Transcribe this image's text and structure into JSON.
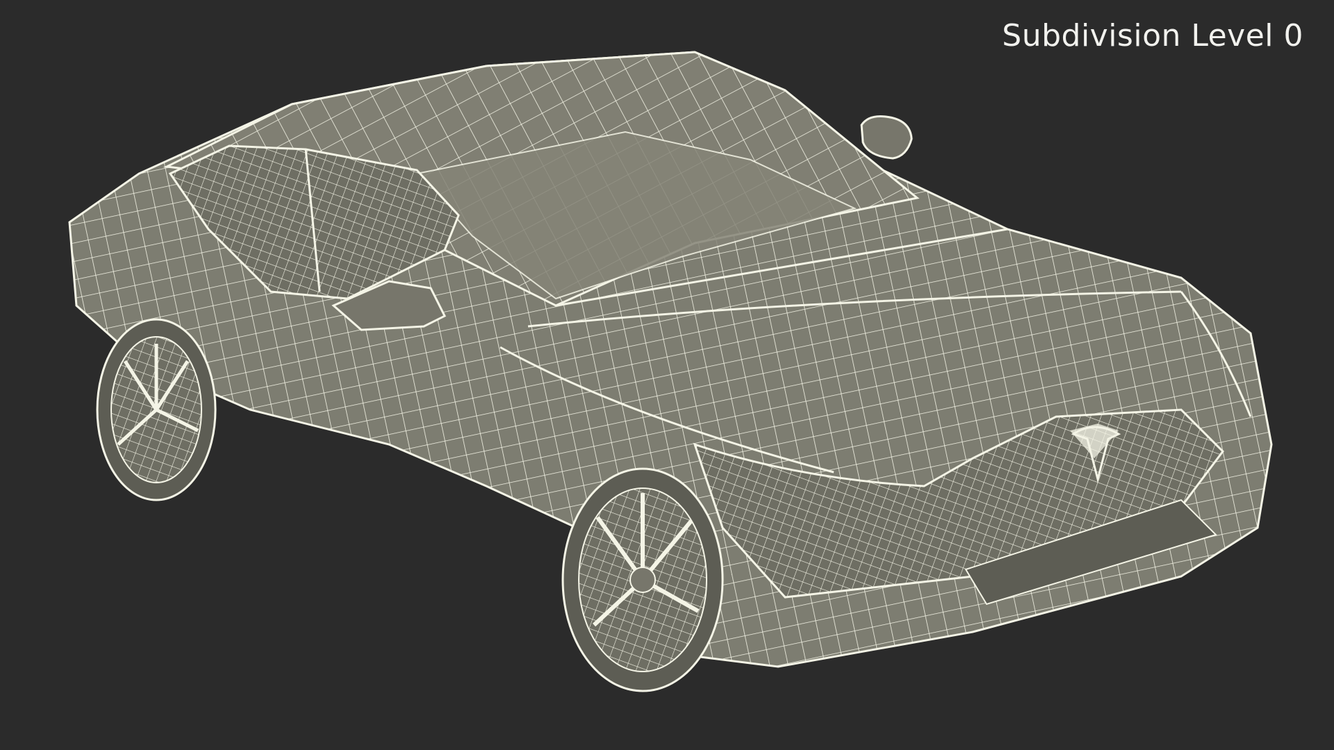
{
  "viewport": {
    "label": "Subdivision Level 0"
  },
  "colors": {
    "background": "#2b2b2b",
    "surface": "#7d7d71",
    "surface_dark": "#5d5d54",
    "wire": "#f4f4e6",
    "label": "#f2f2ee"
  },
  "subject": {
    "icon": "car-wireframe-icon"
  }
}
